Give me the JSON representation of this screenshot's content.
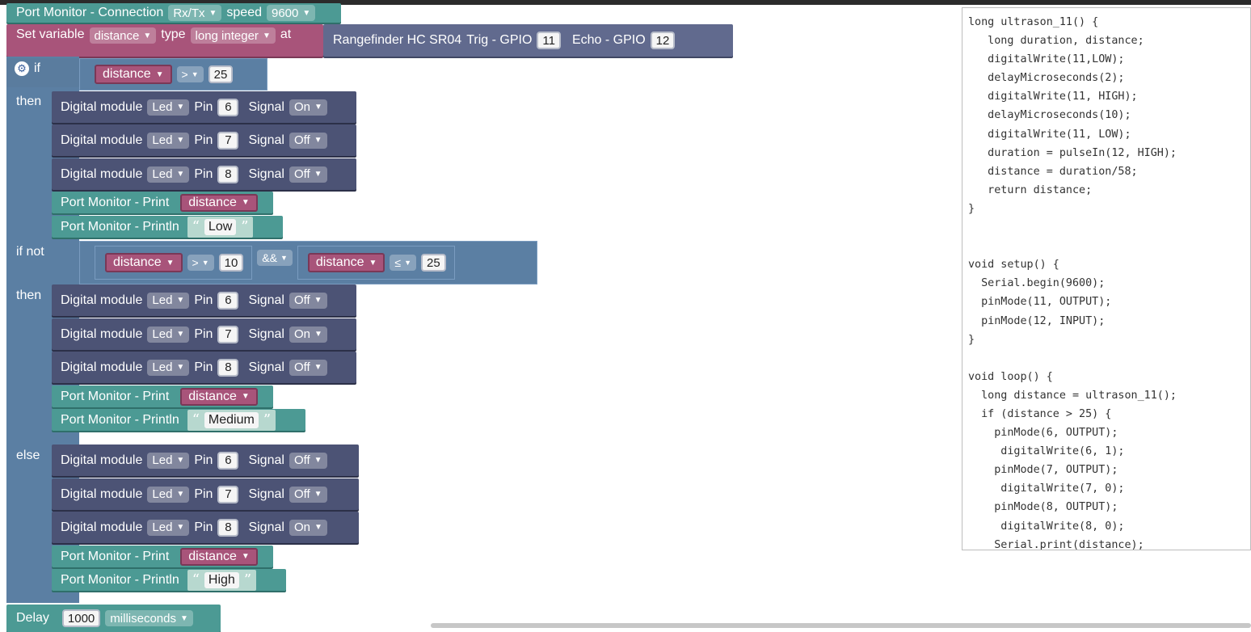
{
  "monitor": {
    "label": "Port Monitor - Connection",
    "mode": "Rx/Tx",
    "speed_label": "speed",
    "speed": "9600"
  },
  "setvar": {
    "label": "Set variable",
    "var": "distance",
    "type_label": "type",
    "type": "long integer",
    "at_label": "at"
  },
  "range": {
    "label": "Rangefinder HC SR04",
    "trig_label": "Trig - GPIO",
    "trig": "11",
    "echo_label": "Echo - GPIO",
    "echo": "12"
  },
  "ifblock": {
    "if_label": "if",
    "then_label": "then",
    "ifnot_label": "if not",
    "else_label": "else",
    "cond1": {
      "var": "distance",
      "op": ">",
      "val": "25"
    },
    "cond2": {
      "var": "distance",
      "op": ">",
      "val": "10",
      "and": "&&",
      "var2": "distance",
      "op2": "≤",
      "val2": "25"
    }
  },
  "digital": {
    "label": "Digital module",
    "module": "Led",
    "pin_label": "Pin",
    "signal_label": "Signal"
  },
  "branch1": {
    "pins": [
      "6",
      "7",
      "8"
    ],
    "signals": [
      "On",
      "Off",
      "Off"
    ],
    "print_label": "Port Monitor - Print",
    "print_var": "distance",
    "println_label": "Port Monitor - Println",
    "println_text": "Low"
  },
  "branch2": {
    "pins": [
      "6",
      "7",
      "8"
    ],
    "signals": [
      "Off",
      "On",
      "Off"
    ],
    "print_label": "Port Monitor - Print",
    "print_var": "distance",
    "println_label": "Port Monitor - Println",
    "println_text": "Medium"
  },
  "branch3": {
    "pins": [
      "6",
      "7",
      "8"
    ],
    "signals": [
      "Off",
      "Off",
      "On"
    ],
    "print_label": "Port Monitor - Print",
    "print_var": "distance",
    "println_label": "Port Monitor - Println",
    "println_text": "High"
  },
  "delay": {
    "label": "Delay",
    "value": "1000",
    "unit": "milliseconds"
  },
  "quote_open": "“",
  "quote_close": "”",
  "code_lines": [
    "long ultrason_11() {",
    "   long duration, distance;",
    "   digitalWrite(11,LOW);",
    "   delayMicroseconds(2);",
    "   digitalWrite(11, HIGH);",
    "   delayMicroseconds(10);",
    "   digitalWrite(11, LOW);",
    "   duration = pulseIn(12, HIGH);",
    "   distance = duration/58;",
    "   return distance;",
    "}",
    "",
    "",
    "void setup() {",
    "  Serial.begin(9600);",
    "  pinMode(11, OUTPUT);",
    "  pinMode(12, INPUT);",
    "}",
    "",
    "void loop() {",
    "  long distance = ultrason_11();",
    "  if (distance > 25) {",
    "    pinMode(6, OUTPUT);",
    "     digitalWrite(6, 1);",
    "    pinMode(7, OUTPUT);",
    "     digitalWrite(7, 0);",
    "    pinMode(8, OUTPUT);",
    "     digitalWrite(8, 0);",
    "    Serial.print(distance);"
  ]
}
